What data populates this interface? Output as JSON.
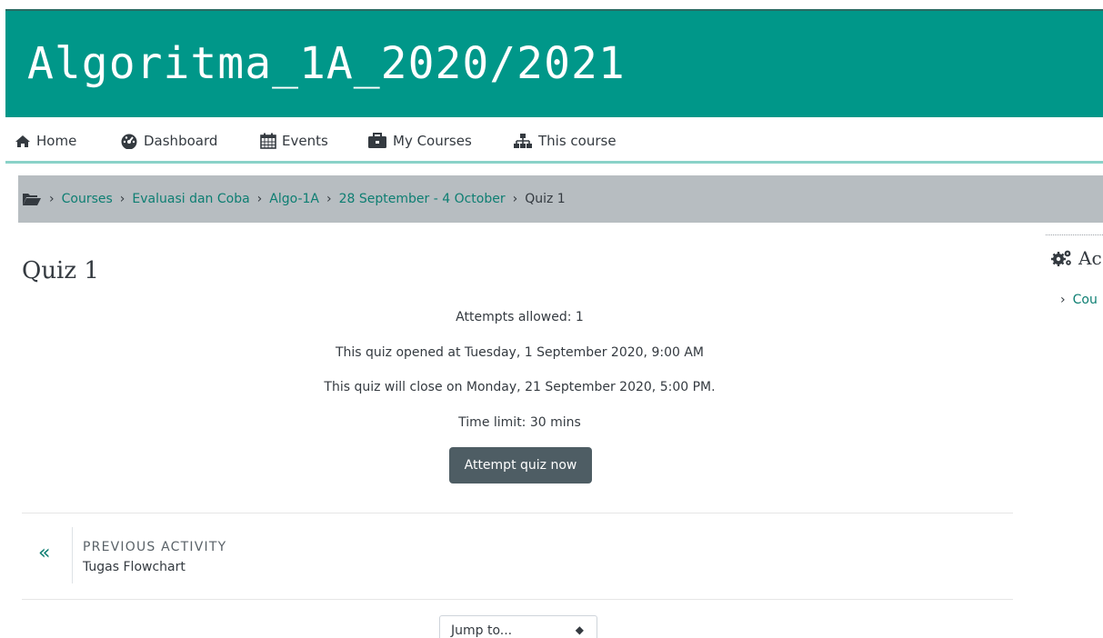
{
  "header": {
    "course_title": "Algoritma_1A_2020/2021"
  },
  "nav": {
    "home": "Home",
    "dashboard": "Dashboard",
    "events": "Events",
    "my_courses": "My Courses",
    "this_course": "This course"
  },
  "breadcrumb": {
    "items": [
      "Courses",
      "Evaluasi dan Coba",
      "Algo-1A",
      "28 September - 4 October"
    ],
    "current": "Quiz 1"
  },
  "page": {
    "title": "Quiz 1",
    "info": [
      "Attempts allowed: 1",
      "This quiz opened at Tuesday, 1 September 2020, 9:00 AM",
      "This quiz will close on Monday, 21 September 2020, 5:00 PM.",
      "Time limit: 30 mins"
    ],
    "attempt_button": "Attempt quiz now"
  },
  "activity_nav": {
    "prev_label": "PREVIOUS ACTIVITY",
    "prev_name": "Tugas Flowchart",
    "jump_placeholder": "Jump to..."
  },
  "side_block": {
    "title": "Ac",
    "link": "Cou"
  },
  "colors": {
    "banner": "#009789",
    "link": "#0d7e72",
    "button": "#4e5d64",
    "breadcrumb_bg": "#b7bdc1"
  }
}
